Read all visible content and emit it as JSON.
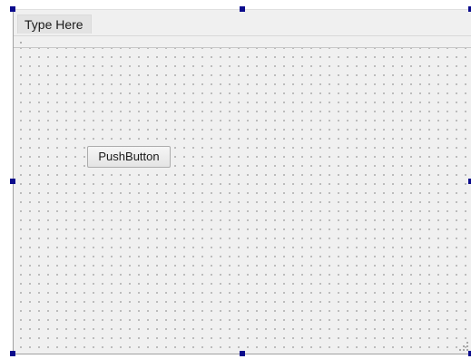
{
  "menubar": {
    "placeholder_item": "Type Here"
  },
  "form": {
    "push_button_label": "PushButton"
  },
  "colors": {
    "selection_handle": "#0b0b8c",
    "form_background": "#f0f0f0",
    "grid_dot": "#8c8c8c"
  },
  "icons": {
    "size_grip": "size-grip-icon",
    "toolbar_grip": "toolbar-grip-icon"
  }
}
